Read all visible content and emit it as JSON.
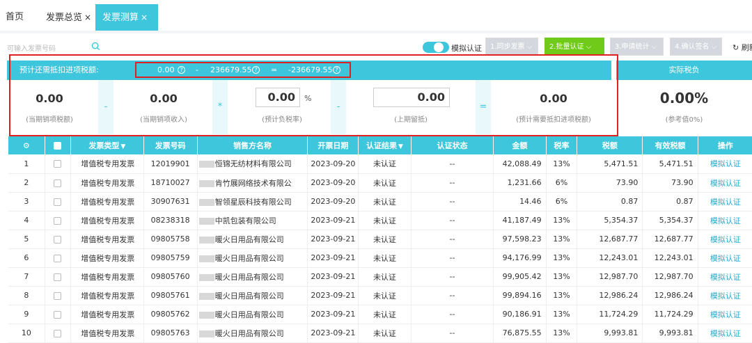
{
  "tabs": {
    "home": "首页",
    "overview": "发票总览",
    "calc": "发票测算",
    "close": "×"
  },
  "toolbar": {
    "search_placeholder": "可输入发票号码",
    "toggle_label": "模拟认证",
    "steps": [
      "1.同步发票",
      "2.批量认证",
      "3.申请统计",
      "4.确认签名"
    ],
    "refresh_label": "刷新"
  },
  "calc": {
    "title": "预计还需抵扣进项税额:",
    "f1": "0.00",
    "minus": "-",
    "f2": "236679.55",
    "eq": "=",
    "f3": "-236679.55",
    "qm": "?",
    "right_title": "实际税负",
    "cells": {
      "sales_tax": {
        "value": "0.00",
        "label": "(当期销项税额)"
      },
      "sales_income": {
        "value": "0.00",
        "label": "(当期销项收入)"
      },
      "rate": {
        "value": "0.00",
        "unit": "%",
        "label": "(预计负税率)"
      },
      "carry": {
        "value": "0.00",
        "label": "(上期留抵)"
      },
      "need": {
        "value": "0.00",
        "label": "(预计需要抵扣进项税额)"
      },
      "actual": {
        "value": "0.00%",
        "label": "(参考值0%)"
      }
    },
    "ops": [
      "-",
      "*",
      "-",
      "="
    ]
  },
  "table": {
    "headers": [
      "发票类型",
      "发票号码",
      "销售方名称",
      "开票日期",
      "认证结果",
      "认证状态",
      "金额",
      "税率",
      "税额",
      "有效税额",
      "操作"
    ],
    "rows": [
      {
        "no": "1",
        "type": "增值税专用发票",
        "code": "12019901",
        "seller": "恒锦无纺材料有限公司",
        "date": "2023-09-20",
        "result": "未认证",
        "status": "--",
        "amount": "42,088.49",
        "rate": "13%",
        "tax": "5,471.51",
        "eff": "5,471.51",
        "action": "模拟认证"
      },
      {
        "no": "2",
        "type": "增值税专用发票",
        "code": "18710027",
        "seller": "肯竹展网络技术有限公",
        "date": "2023-09-20",
        "result": "未认证",
        "status": "--",
        "amount": "1,231.66",
        "rate": "6%",
        "tax": "73.90",
        "eff": "73.90",
        "action": "模拟认证"
      },
      {
        "no": "3",
        "type": "增值税专用发票",
        "code": "30907631",
        "seller": "智领星辰科技有限公司",
        "date": "2023-09-20",
        "result": "未认证",
        "status": "--",
        "amount": "14.46",
        "rate": "6%",
        "tax": "0.87",
        "eff": "0.87",
        "action": "模拟认证"
      },
      {
        "no": "4",
        "type": "增值税专用发票",
        "code": "08238318",
        "seller": "中凯包装有限公司",
        "date": "2023-09-21",
        "result": "未认证",
        "status": "--",
        "amount": "41,187.49",
        "rate": "13%",
        "tax": "5,354.37",
        "eff": "5,354.37",
        "action": "模拟认证"
      },
      {
        "no": "5",
        "type": "增值税专用发票",
        "code": "09805758",
        "seller": "暖火日用品有限公司",
        "date": "2023-09-21",
        "result": "未认证",
        "status": "--",
        "amount": "97,598.23",
        "rate": "13%",
        "tax": "12,687.77",
        "eff": "12,687.77",
        "action": "模拟认证"
      },
      {
        "no": "6",
        "type": "增值税专用发票",
        "code": "09805759",
        "seller": "暖火日用品有限公司",
        "date": "2023-09-21",
        "result": "未认证",
        "status": "--",
        "amount": "94,176.99",
        "rate": "13%",
        "tax": "12,243.01",
        "eff": "12,243.01",
        "action": "模拟认证"
      },
      {
        "no": "7",
        "type": "增值税专用发票",
        "code": "09805760",
        "seller": "暖火日用品有限公司",
        "date": "2023-09-21",
        "result": "未认证",
        "status": "--",
        "amount": "99,905.42",
        "rate": "13%",
        "tax": "12,987.70",
        "eff": "12,987.70",
        "action": "模拟认证"
      },
      {
        "no": "8",
        "type": "增值税专用发票",
        "code": "09805761",
        "seller": "暖火日用品有限公司",
        "date": "2023-09-21",
        "result": "未认证",
        "status": "--",
        "amount": "99,894.16",
        "rate": "13%",
        "tax": "12,986.24",
        "eff": "12,986.24",
        "action": "模拟认证"
      },
      {
        "no": "9",
        "type": "增值税专用发票",
        "code": "09805762",
        "seller": "暖火日用品有限公司",
        "date": "2023-09-21",
        "result": "未认证",
        "status": "--",
        "amount": "90,186.91",
        "rate": "13%",
        "tax": "11,724.29",
        "eff": "11,724.29",
        "action": "模拟认证"
      },
      {
        "no": "10",
        "type": "增值税专用发票",
        "code": "09805763",
        "seller": "暖火日用品有限公司",
        "date": "2023-09-21",
        "result": "未认证",
        "status": "--",
        "amount": "76,875.55",
        "rate": "13%",
        "tax": "9,993.81",
        "eff": "9,993.81",
        "action": "模拟认证"
      }
    ]
  }
}
